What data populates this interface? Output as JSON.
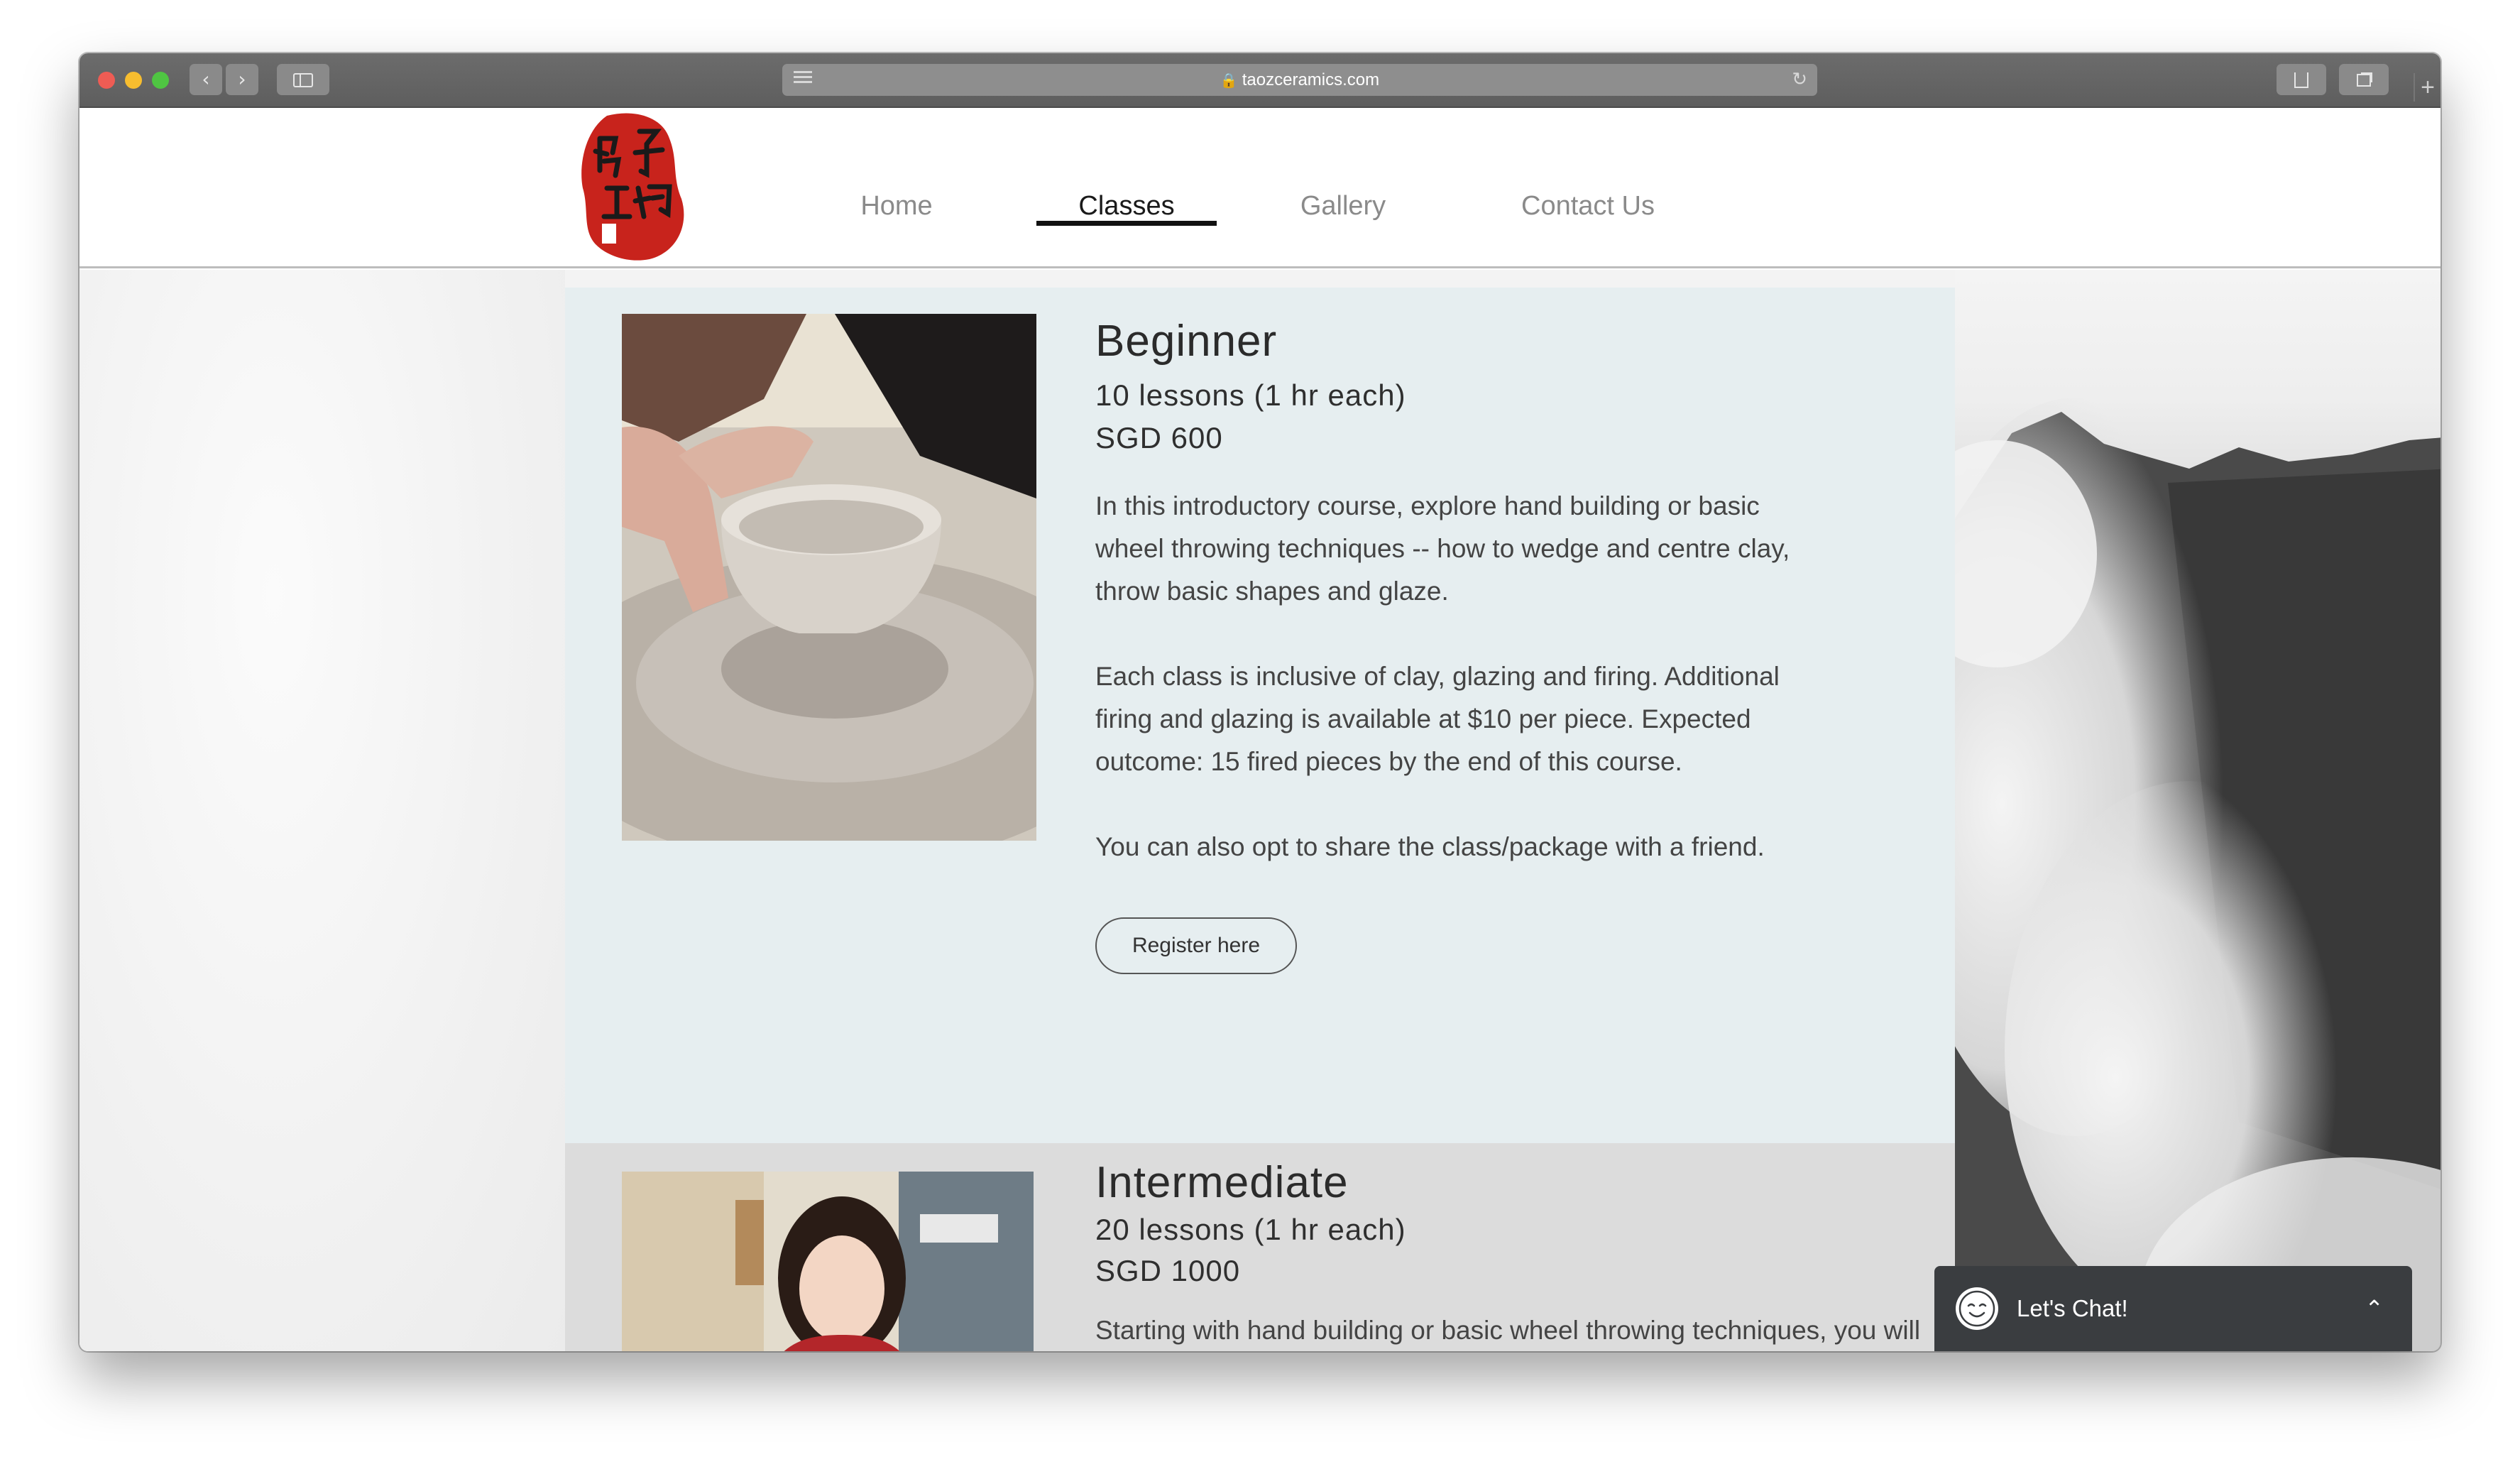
{
  "browser": {
    "url": "taozceramics.com",
    "back_icon": "‹",
    "forward_icon": "›",
    "reload_icon": "↻",
    "new_tab_icon": "+"
  },
  "nav": {
    "items": [
      {
        "label": "Home"
      },
      {
        "label": "Classes",
        "active": true
      },
      {
        "label": "Gallery"
      },
      {
        "label": "Contact Us"
      }
    ]
  },
  "beginner": {
    "title": "Beginner",
    "lessons": "10 lessons (1 hr each)",
    "price": "SGD 600",
    "para1": "In this introductory course, explore hand building or basic wheel throwing techniques -- how to wedge and centre clay, throw basic shapes and glaze.",
    "para2": "Each class is inclusive of clay, glazing and firing. Additional firing and glazing is available at $10 per piece. Expected outcome: 15 fired pieces by the end of this course.",
    "para3": "You can also opt to share the class/package with a friend.",
    "register_label": "Register here"
  },
  "intermediate": {
    "title": "Intermediate",
    "lessons": "20 lessons (1 hr each)",
    "price": "SGD 1000",
    "para1": "Starting with hand building or basic wheel throwing techniques, you will"
  },
  "chat": {
    "label": "Let's Chat!",
    "chevron": "⌃"
  },
  "colors": {
    "beginner_bg": "#e6eef0",
    "intermediate_bg": "#dcdcdc",
    "logo_red": "#c8231c",
    "chat_bg": "#3a3d40"
  }
}
